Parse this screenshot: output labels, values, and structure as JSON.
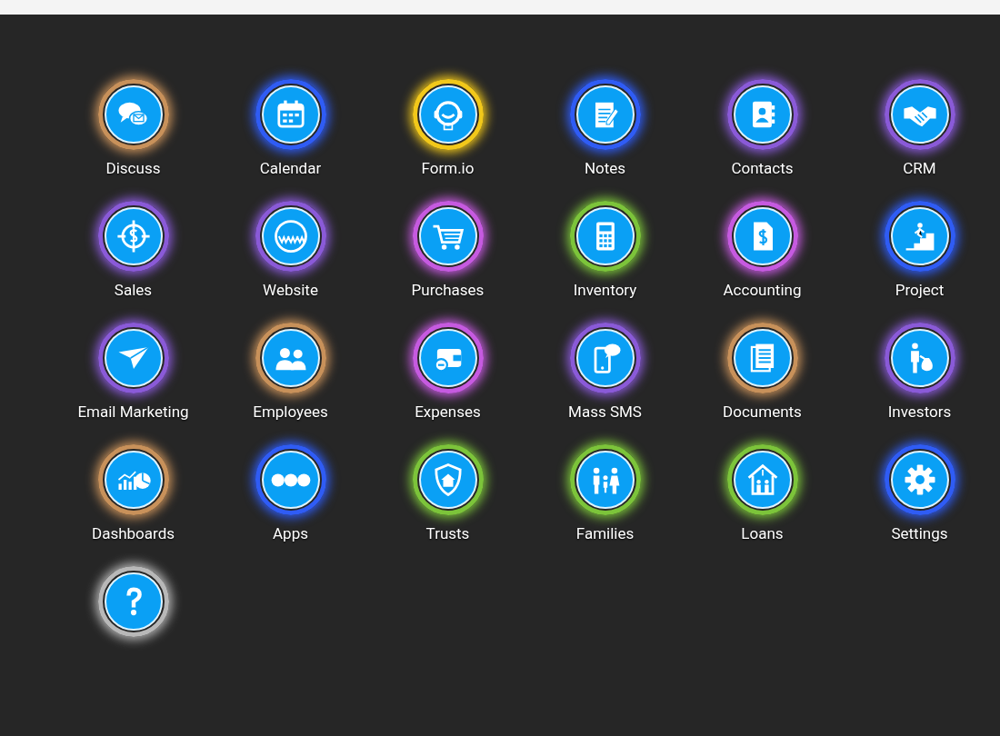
{
  "apps": [
    {
      "label": "Discuss",
      "color": "#c8915a"
    },
    {
      "label": "Calendar",
      "color": "#2f5cf5"
    },
    {
      "label": "Form.io",
      "color": "#f2c81a"
    },
    {
      "label": "Notes",
      "color": "#2f5cf5"
    },
    {
      "label": "Contacts",
      "color": "#8a5ad8"
    },
    {
      "label": "CRM",
      "color": "#8a5ad8"
    },
    {
      "label": "Sales",
      "color": "#8a5ad8"
    },
    {
      "label": "Website",
      "color": "#8a5ad8"
    },
    {
      "label": "Purchases",
      "color": "#c65ae0"
    },
    {
      "label": "Inventory",
      "color": "#7cc43a"
    },
    {
      "label": "Accounting",
      "color": "#c65ae0"
    },
    {
      "label": "Project",
      "color": "#2f5cf5"
    },
    {
      "label": "Email Marketing",
      "color": "#8a5ad8"
    },
    {
      "label": "Employees",
      "color": "#c8915a"
    },
    {
      "label": "Expenses",
      "color": "#c65ae0"
    },
    {
      "label": "Mass SMS",
      "color": "#8a5ad8"
    },
    {
      "label": "Documents",
      "color": "#c8915a"
    },
    {
      "label": "Investors",
      "color": "#8a5ad8"
    },
    {
      "label": "Dashboards",
      "color": "#c8915a"
    },
    {
      "label": "Apps",
      "color": "#2f5cf5"
    },
    {
      "label": "Trusts",
      "color": "#7cc43a"
    },
    {
      "label": "Families",
      "color": "#7cc43a"
    },
    {
      "label": "Loans",
      "color": "#7cc43a"
    },
    {
      "label": "Settings",
      "color": "#2f5cf5"
    },
    {
      "color": "#b8b8b8"
    }
  ]
}
